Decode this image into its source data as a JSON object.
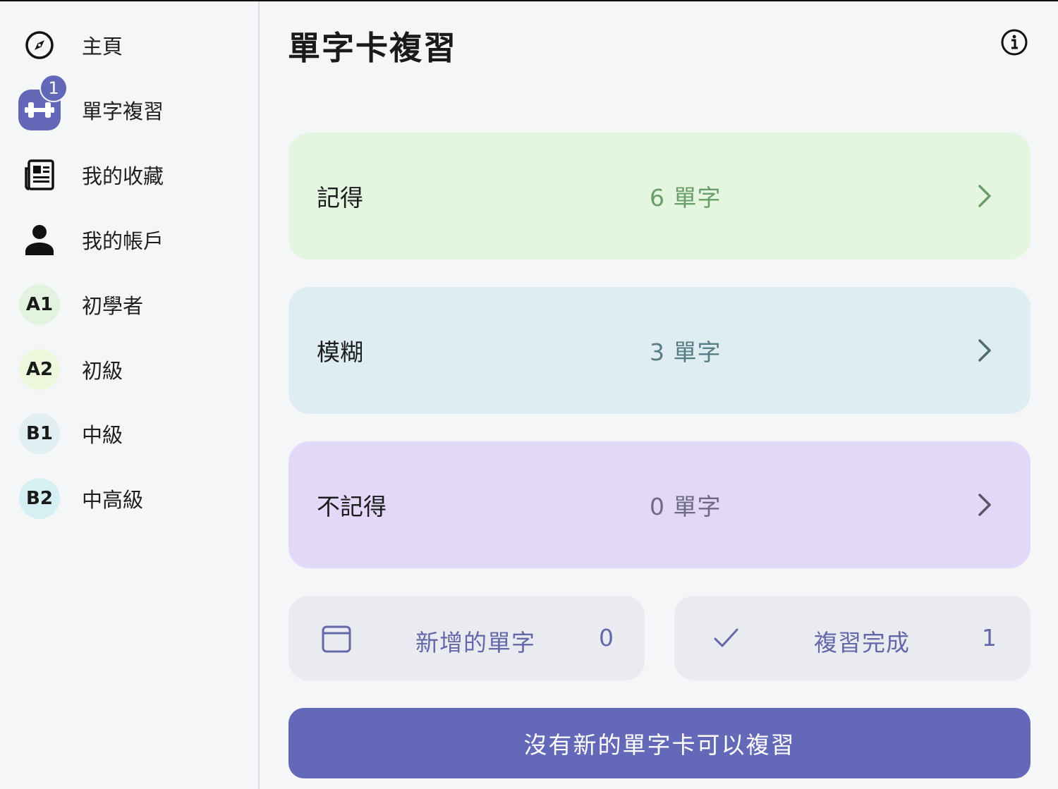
{
  "sidebar": {
    "items": [
      {
        "label": "主頁",
        "icon": "compass-icon"
      },
      {
        "label": "單字複習",
        "icon": "dumbbell-icon",
        "badge": "1"
      },
      {
        "label": "我的收藏",
        "icon": "newspaper-icon"
      },
      {
        "label": "我的帳戶",
        "icon": "person-icon"
      },
      {
        "label": "初學者",
        "level": "A1",
        "color": "#e2f3e0"
      },
      {
        "label": "初級",
        "level": "A2",
        "color": "#eef7dc"
      },
      {
        "label": "中級",
        "level": "B1",
        "color": "#e2eff2"
      },
      {
        "label": "中高級",
        "level": "B2",
        "color": "#d6eff2"
      }
    ]
  },
  "header": {
    "title": "單字卡複習",
    "info_icon": "info-icon"
  },
  "cards": [
    {
      "label": "記得",
      "count": "6 單字",
      "bg": "#e4f5e0",
      "count_color": "#6a9d6a",
      "chev_color": "#6a9d6a"
    },
    {
      "label": "模糊",
      "count": "3 單字",
      "bg": "#deedf1",
      "count_color": "#587c86",
      "chev_color": "#4d6b74"
    },
    {
      "label": "不記得",
      "count": "0 單字",
      "bg": "#e2d8f7",
      "count_color": "#6f6a82",
      "chev_color": "#5a5668"
    }
  ],
  "stats": [
    {
      "label": "新增的單字",
      "value": "0",
      "icon": "calendar-icon"
    },
    {
      "label": "複習完成",
      "value": "1",
      "icon": "check-icon"
    }
  ],
  "action": {
    "label": "沒有新的單字卡可以複習"
  },
  "colors": {
    "accent": "#6468b8",
    "stat_text": "#6468a8"
  }
}
